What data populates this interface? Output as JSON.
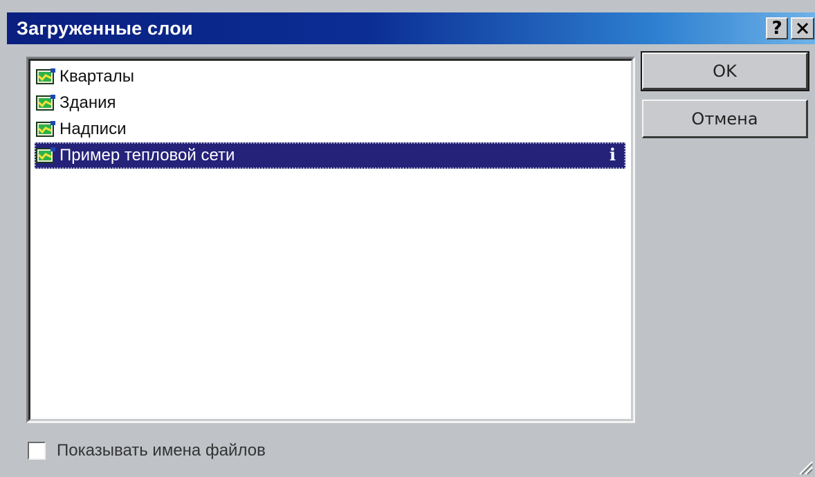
{
  "dialog": {
    "title": "Загруженные слои",
    "help_glyph": "?",
    "close_glyph": "✕"
  },
  "layers": {
    "items": [
      {
        "label": "Кварталы",
        "icon": "layer-map-icon",
        "selected": false
      },
      {
        "label": "Здания",
        "icon": "layer-map-icon",
        "selected": false
      },
      {
        "label": "Надписи",
        "icon": "layer-map-icon",
        "selected": false
      },
      {
        "label": "Пример тепловой сети",
        "icon": "layer-map-icon",
        "selected": true,
        "info_glyph": "i"
      }
    ]
  },
  "buttons": {
    "ok_label": "OK",
    "cancel_label": "Отмена"
  },
  "options": {
    "show_filenames_label": "Показывать имена файлов",
    "show_filenames_checked": false
  },
  "colors": {
    "title_gradient_start": "#0a1f80",
    "title_gradient_end": "#6fb2e8",
    "selection": "#25227a",
    "dialog_bg": "#bfc3c7"
  }
}
